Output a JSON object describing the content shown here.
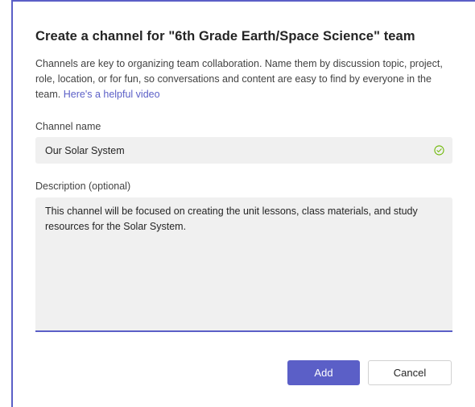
{
  "dialog": {
    "title": "Create a channel for \"6th Grade Earth/Space Science\" team",
    "description": "Channels are key to organizing team collaboration. Name them by discussion topic, project, role, location, or for fun, so conversations and content are easy to find by everyone in the team.",
    "help_link": "Here's a helpful video",
    "channel_name_label": "Channel name",
    "channel_name_value": "Our Solar System",
    "description_label": "Description (optional)",
    "description_value": "This channel will be focused on creating the unit lessons, class materials, and study resources for the Solar System.",
    "add_label": "Add",
    "cancel_label": "Cancel"
  },
  "colors": {
    "accent": "#5b5fc7",
    "valid": "#6bb700",
    "field_bg": "#f0f0f0"
  },
  "icons": {
    "name_valid": "check-circle-icon"
  }
}
